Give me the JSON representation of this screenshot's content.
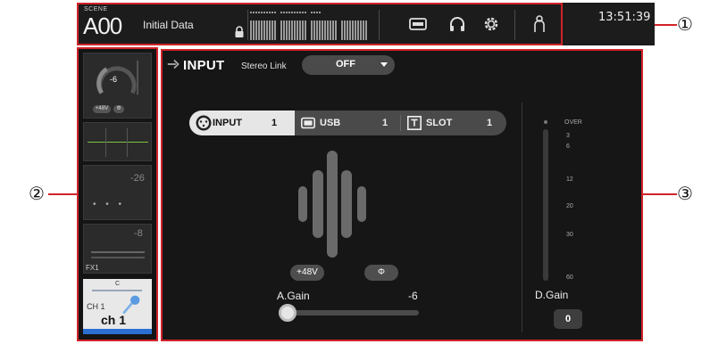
{
  "callouts": {
    "c1": "①",
    "c2": "②",
    "c3": "③"
  },
  "topbar": {
    "scene_label": "SCENE",
    "scene_number": "A00",
    "scene_name": "Initial Data",
    "time": "13:51:39",
    "icons": [
      "lock-icon",
      "recorder-icon",
      "headphones-icon",
      "gear-icon",
      "user-icon"
    ]
  },
  "strip": {
    "gain_value": "-6",
    "phantom_label": "+48V",
    "phase_label": "Φ",
    "level_value_1": "-26",
    "level_value_2": "-8",
    "fx_label": "FX1",
    "pan_label": "C",
    "channel_id": "CH 1",
    "channel_name": "ch 1"
  },
  "input": {
    "title": "INPUT",
    "stereo_link_label": "Stereo Link",
    "stereo_link_value": "OFF",
    "sources": [
      {
        "label": "INPUT",
        "number": "1"
      },
      {
        "label": "USB",
        "number": "1"
      },
      {
        "label": "SLOT",
        "number": "1"
      }
    ],
    "phantom_label": "+48V",
    "phase_label": "Φ",
    "again_label": "A.Gain",
    "again_value": "-6",
    "dgain_label": "D.Gain",
    "dgain_value": "0",
    "meter_scale": [
      "OVER",
      "3",
      "6",
      "12",
      "20",
      "30",
      "60"
    ]
  },
  "colors": {
    "callout_red": "#d2232a",
    "active_tab": "#e6e6e6",
    "channel_blue": "#2a6fd1"
  }
}
